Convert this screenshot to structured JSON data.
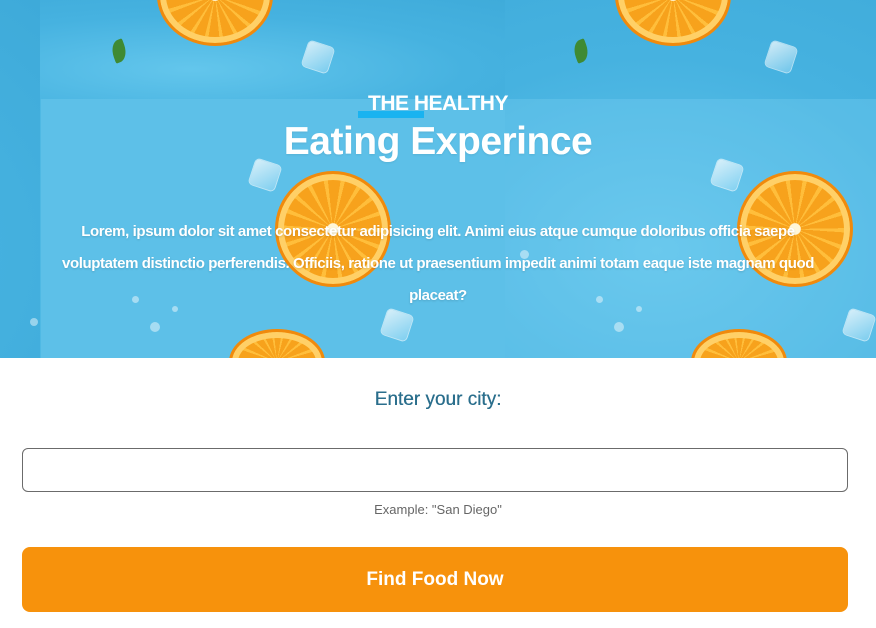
{
  "hero": {
    "kicker": "THE HEALTHY",
    "headline": "Eating Experince",
    "lead": "Lorem, ipsum dolor sit amet consectetur adipisicing elit. Animi eius atque cumque doloribus officia saepe voluptatem distinctio perferendis. Officiis, ratione ut praesentium impedit animi totam eaque iste magnam quod placeat?",
    "background_image": "oranges-and-ice-on-blue"
  },
  "form": {
    "label": "Enter your city:",
    "city_value": "",
    "hint": "Example: \"San Diego\"",
    "submit_label": "Find Food Now"
  },
  "colors": {
    "hero_blue": "#4fb9e4",
    "accent_blue": "#19b3f0",
    "label_teal": "#2a6e8c",
    "cta_orange": "#f7920c"
  }
}
